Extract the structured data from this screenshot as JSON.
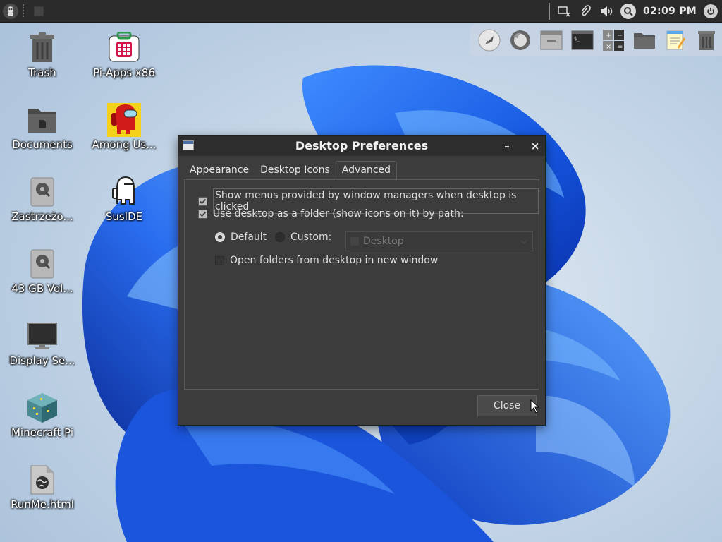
{
  "panel": {
    "clock": "02:09 PM",
    "icons": [
      "app-menu-icon",
      "screen-capture-icon",
      "clipboard-icon",
      "volume-icon",
      "search-icon",
      "power-icon"
    ]
  },
  "dock": {
    "items": [
      "rocket-launcher-icon",
      "firefox-icon",
      "file-manager-icon",
      "terminal-icon",
      "calculator-icon",
      "folder-icon",
      "text-editor-icon",
      "trash-icon"
    ]
  },
  "desktop_icons": [
    {
      "label": "Trash",
      "icon": "trash-icon"
    },
    {
      "label": "Pi-Apps x86",
      "icon": "pi-apps-icon"
    },
    {
      "label": "Documents",
      "icon": "folder-icon"
    },
    {
      "label": "Among Us...",
      "icon": "among-us-icon"
    },
    {
      "label": "Zastrzeżo...",
      "icon": "drive-icon"
    },
    {
      "label": "SusIDE",
      "icon": "susIDE-icon"
    },
    {
      "label": "43 GB Vol...",
      "icon": "drive-icon"
    },
    {
      "label": "Display Se...",
      "icon": "monitor-icon"
    },
    {
      "label": "Minecraft Pi",
      "icon": "minecraft-icon"
    },
    {
      "label": "RunMe.html",
      "icon": "html-file-icon"
    }
  ],
  "dialog": {
    "title": "Desktop Preferences",
    "minimize": "–",
    "close_x": "×",
    "tabs": [
      "Appearance",
      "Desktop Icons",
      "Advanced"
    ],
    "active_tab": "Advanced",
    "options": {
      "show_menus": {
        "label": "Show menus provided by window managers when desktop is clicked",
        "checked": true
      },
      "use_folder": {
        "label": "Use desktop as a folder (show icons on it) by path:",
        "checked": true
      },
      "radio_default": {
        "label": "Default",
        "selected": true
      },
      "radio_custom": {
        "label": "Custom:",
        "selected": false
      },
      "path_value": "Desktop",
      "open_new_window": {
        "label": "Open folders from desktop in new window",
        "checked": false
      }
    },
    "close_button": "Close"
  },
  "colors": {
    "panel_bg": "#2b2b2b",
    "dialog_bg": "#3c3c3c",
    "wallpaper_blue": "#1e5fe0",
    "wallpaper_bg": "#c5d6e6"
  }
}
